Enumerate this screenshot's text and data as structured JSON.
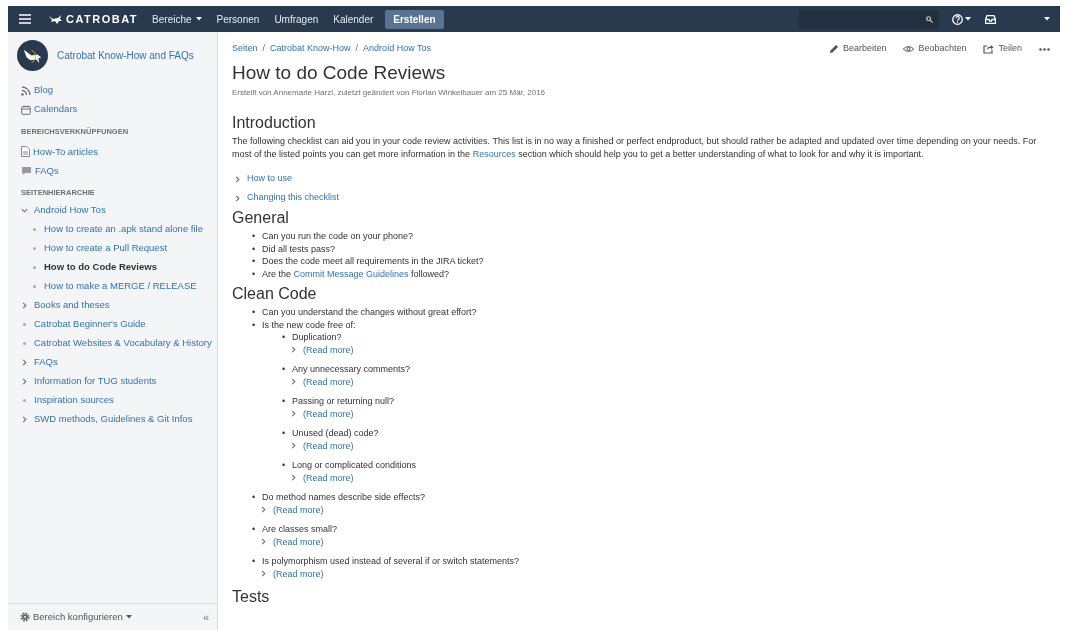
{
  "header": {
    "logo": "CATROBAT",
    "nav": [
      {
        "label": "Bereiche",
        "dropdown": true
      },
      {
        "label": "Personen",
        "dropdown": false
      },
      {
        "label": "Umfragen",
        "dropdown": false
      },
      {
        "label": "Kalender",
        "dropdown": false
      }
    ],
    "create": "Erstellen"
  },
  "sidebar": {
    "space_name": "Catrobat Know-How and FAQs",
    "links": [
      {
        "label": "Blog",
        "kind": "blog"
      },
      {
        "label": "Calendars",
        "kind": "calendar"
      }
    ],
    "shortcuts_heading": "BEREICHSVERKNÜPFUNGEN",
    "shortcuts": [
      {
        "label": "How-To articles",
        "kind": "document"
      },
      {
        "label": "FAQs",
        "kind": "chat"
      }
    ],
    "tree_heading": "SEITENHIERARCHIE",
    "tree": [
      {
        "label": "Android How Tos",
        "kind": "branch",
        "expanded": true,
        "selected": false,
        "children": [
          {
            "label": "How to create an .apk stand alone file",
            "kind": "leaf",
            "selected": false
          },
          {
            "label": "How to create a Pull Request",
            "kind": "leaf",
            "selected": false
          },
          {
            "label": "How to do Code Reviews",
            "kind": "leaf",
            "selected": true
          },
          {
            "label": "How to make a MERGE / RELEASE",
            "kind": "leaf",
            "selected": false
          }
        ]
      },
      {
        "label": "Books and theses",
        "kind": "branch",
        "expanded": false,
        "selected": false
      },
      {
        "label": "Catrobat Beginner's Guide",
        "kind": "leaf",
        "selected": false
      },
      {
        "label": "Catrobat Websites & Vocabulary & History",
        "kind": "leaf",
        "selected": false
      },
      {
        "label": "FAQs",
        "kind": "branch",
        "expanded": false,
        "selected": false
      },
      {
        "label": "Information for TUG students",
        "kind": "branch",
        "expanded": false,
        "selected": false
      },
      {
        "label": "Inspiration sources",
        "kind": "leaf",
        "selected": false
      },
      {
        "label": "SWD methods, Guidelines & Git Infos",
        "kind": "branch",
        "expanded": false,
        "selected": false
      }
    ],
    "configure": "Bereich konfigurieren",
    "collapse": "«"
  },
  "page": {
    "breadcrumbs": [
      "Seiten",
      "Catrobat Know-How",
      "Android How Tos"
    ],
    "breadcrumb_separators": [
      "/",
      "/"
    ],
    "actions": [
      {
        "label": "Bearbeiten",
        "kind": "edit"
      },
      {
        "label": "Beobachten",
        "kind": "watch"
      },
      {
        "label": "Teilen",
        "kind": "share"
      }
    ],
    "title": "How to do Code Reviews",
    "byline": "Erstellt von Annemarie Harzl, zuletzt geändert von Florian Winkelbauer am 25 Mär, 2016",
    "sections": [
      {
        "heading": "Introduction",
        "paragraph": [
          {
            "text": "The following checklist can aid you in your code review activities. This list is in no way a finished or perfect endproduct, but should rather be adapted and updated over time depending on your needs. For most of the listed points you can get more information in the "
          },
          {
            "link": "Resources"
          },
          {
            "text": " section which should help you to get a better understanding of what to look for and why it is important."
          }
        ],
        "expanders": [
          "How to use",
          "Changing this checklist"
        ]
      },
      {
        "heading": "General",
        "items": [
          {
            "marker": "•",
            "parts": [
              {
                "text": "Can you run the code on your phone?"
              }
            ]
          },
          {
            "marker": "•",
            "parts": [
              {
                "text": "Did all tests pass?"
              }
            ]
          },
          {
            "marker": "•",
            "parts": [
              {
                "text": "Does the code meet all requirements in the JIRA ticket?"
              }
            ]
          },
          {
            "marker": "•",
            "parts": [
              {
                "text": "Are the "
              },
              {
                "link": "Commit Message Guidelines"
              },
              {
                "text": " followed?"
              }
            ]
          }
        ]
      },
      {
        "heading": "Clean Code",
        "items": [
          {
            "marker": "•",
            "parts": [
              {
                "text": "Can you understand the changes without great effort?"
              }
            ]
          },
          {
            "marker": "•",
            "parts": [
              {
                "text": "Is the new code free of:"
              }
            ],
            "children": [
              {
                "marker": "•",
                "parts": [
                  {
                    "text": "Duplication?"
                  }
                ],
                "read_more": "(Read more)"
              },
              {
                "marker": "•",
                "parts": [
                  {
                    "text": "Any unnecessary comments?"
                  }
                ],
                "read_more": "(Read more)"
              },
              {
                "marker": "•",
                "parts": [
                  {
                    "text": "Passing or returning null?"
                  }
                ],
                "read_more": "(Read more)"
              },
              {
                "marker": "•",
                "parts": [
                  {
                    "text": "Unused (dead) code?"
                  }
                ],
                "read_more": "(Read more)"
              },
              {
                "marker": "•",
                "parts": [
                  {
                    "text": "Long or complicated conditions"
                  }
                ],
                "read_more": "(Read more)"
              }
            ]
          },
          {
            "marker": "•",
            "parts": [
              {
                "text": "Do method names describe side effects?"
              }
            ],
            "read_more": "(Read more)"
          },
          {
            "marker": "•",
            "parts": [
              {
                "text": "Are classes small?"
              }
            ],
            "read_more": "(Read more)"
          },
          {
            "marker": "•",
            "parts": [
              {
                "text": "Is polymorphism used instead of several if or switch statements?"
              }
            ],
            "read_more": "(Read more)"
          }
        ]
      },
      {
        "heading": "Tests"
      }
    ]
  }
}
